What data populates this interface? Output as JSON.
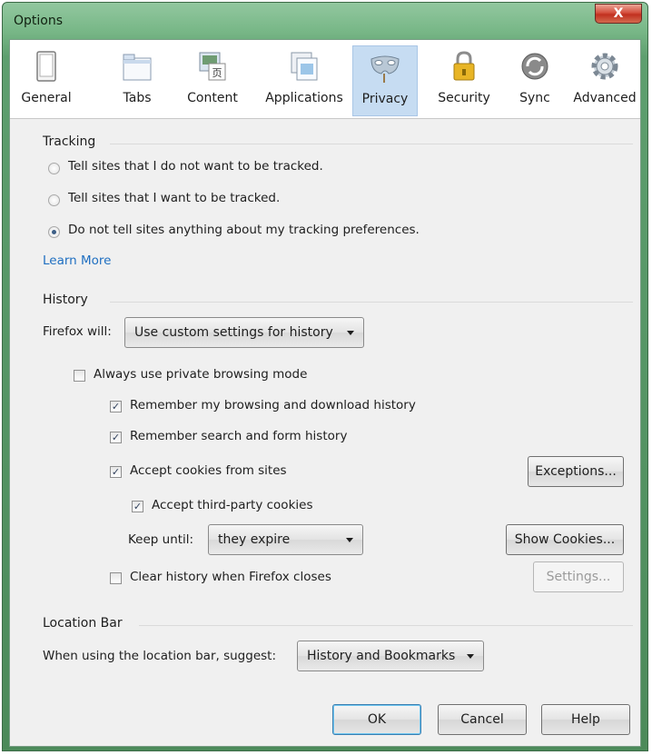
{
  "window": {
    "title": "Options",
    "close_label": "X"
  },
  "toolbar": {
    "tabs": [
      {
        "label": "General",
        "icon": "general-icon"
      },
      {
        "label": "Tabs",
        "icon": "tabs-icon"
      },
      {
        "label": "Content",
        "icon": "content-icon"
      },
      {
        "label": "Applications",
        "icon": "applications-icon"
      },
      {
        "label": "Privacy",
        "icon": "privacy-mask-icon",
        "selected": true
      },
      {
        "label": "Security",
        "icon": "padlock-icon"
      },
      {
        "label": "Sync",
        "icon": "sync-icon"
      },
      {
        "label": "Advanced",
        "icon": "gear-icon"
      }
    ]
  },
  "tracking": {
    "title": "Tracking",
    "options": [
      {
        "label": "Tell sites that I do not want to be tracked.",
        "checked": false
      },
      {
        "label": "Tell sites that I want to be tracked.",
        "checked": false
      },
      {
        "label": "Do not tell sites anything about my tracking preferences.",
        "checked": true
      }
    ],
    "learn_more": "Learn More"
  },
  "history": {
    "title": "History",
    "firefox_will_label": "Firefox will:",
    "firefox_will_value": "Use custom settings for history",
    "always_private": {
      "label": "Always use private browsing mode",
      "checked": false
    },
    "remember_browsing": {
      "label": "Remember my browsing and download history",
      "checked": true
    },
    "remember_search": {
      "label": "Remember search and form history",
      "checked": true
    },
    "accept_cookies": {
      "label": "Accept cookies from sites",
      "checked": true
    },
    "exceptions_button": "Exceptions...",
    "accept_third_party": {
      "label": "Accept third-party cookies",
      "checked": true
    },
    "keep_until_label": "Keep until:",
    "keep_until_value": "they expire",
    "show_cookies_button": "Show Cookies...",
    "clear_history": {
      "label": "Clear history when Firefox closes",
      "checked": false
    },
    "settings_button": "Settings..."
  },
  "location_bar": {
    "title": "Location Bar",
    "suggest_label": "When using the location bar, suggest:",
    "suggest_value": "History and Bookmarks"
  },
  "footer": {
    "ok": "OK",
    "cancel": "Cancel",
    "help": "Help"
  },
  "colors": {
    "window_frame": "#79b888",
    "selected_tab": "#c6dcf2",
    "link": "#1f6fc1",
    "close_button": "#d4503e"
  }
}
